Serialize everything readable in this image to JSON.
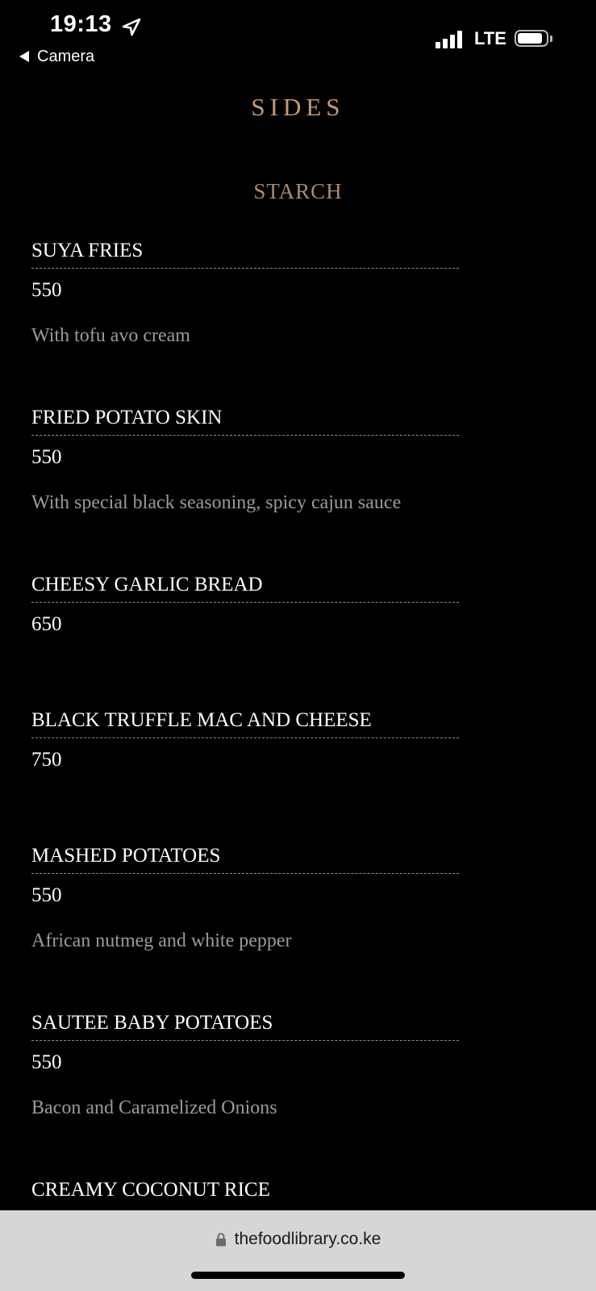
{
  "status_bar": {
    "time": "19:13",
    "back_app": "Camera",
    "network": "LTE",
    "icons": [
      "location-arrow-icon",
      "back-triangle-icon",
      "signal-icon",
      "battery-icon"
    ]
  },
  "menu": {
    "section_title": "SIDES",
    "category_title": "STARCH",
    "items": [
      {
        "name": "SUYA FRIES",
        "price": "550",
        "description": "With tofu avo cream"
      },
      {
        "name": "FRIED POTATO SKIN",
        "price": "550",
        "description": "With special black seasoning, spicy cajun sauce"
      },
      {
        "name": "CHEESY GARLIC BREAD",
        "price": "650",
        "description": ""
      },
      {
        "name": "BLACK TRUFFLE MAC AND CHEESE",
        "price": "750",
        "description": ""
      },
      {
        "name": "MASHED POTATOES",
        "price": "550",
        "description": "African nutmeg and white pepper"
      },
      {
        "name": "SAUTEE BABY POTATOES",
        "price": "550",
        "description": "Bacon and Caramelized Onions"
      },
      {
        "name": "CREAMY COCONUT RICE",
        "price": "",
        "description": ""
      }
    ]
  },
  "browser": {
    "url": "thefoodlibrary.co.ke",
    "icons": [
      "lock-icon"
    ]
  },
  "colors": {
    "background": "#000000",
    "heading_accent": "#c49a78",
    "category_accent": "#a98a73",
    "description_text": "#9a9a9a",
    "bottom_bar": "#d6d6d6"
  }
}
